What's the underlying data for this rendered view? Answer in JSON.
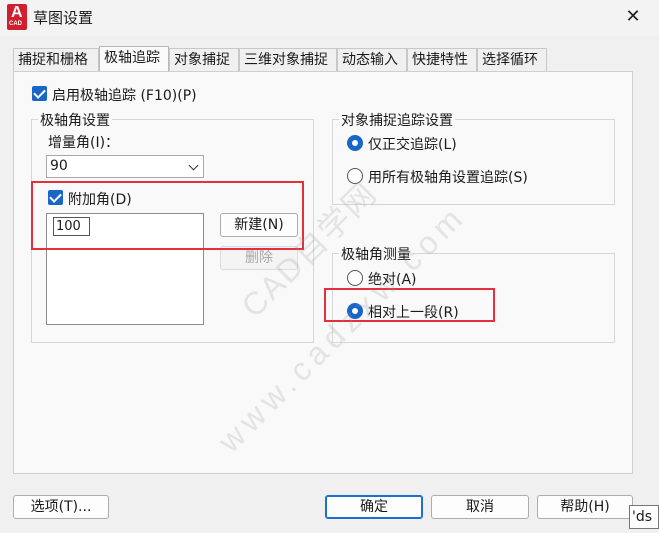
{
  "window": {
    "title": "草图设置",
    "app_icon_letter": "A",
    "app_icon_sub": "CAD",
    "close_glyph": "✕"
  },
  "tabs": [
    {
      "label": "捕捉和栅格",
      "active": false
    },
    {
      "label": "极轴追踪",
      "active": true
    },
    {
      "label": "对象捕捉",
      "active": false
    },
    {
      "label": "三维对象捕捉",
      "active": false
    },
    {
      "label": "动态输入",
      "active": false
    },
    {
      "label": "快捷特性",
      "active": false
    },
    {
      "label": "选择循环",
      "active": false
    }
  ],
  "enable_polar": {
    "label": "启用极轴追踪 (F10)(P)",
    "checked": true
  },
  "polar_angle_settings": {
    "title": "极轴角设置",
    "increment_label": "增量角(I)：",
    "increment_value": "90",
    "additional_label": "附加角(D)",
    "additional_checked": true,
    "additional_values": [
      "100"
    ],
    "new_button": "新建(N)",
    "delete_button": "删除"
  },
  "object_snap_tracking": {
    "title": "对象捕捉追踪设置",
    "options": [
      {
        "label": "仅正交追踪(L)",
        "selected": true
      },
      {
        "label": "用所有极轴角设置追踪(S)",
        "selected": false
      }
    ]
  },
  "polar_measurement": {
    "title": "极轴角测量",
    "options": [
      {
        "label": "绝对(A)",
        "selected": false
      },
      {
        "label": "相对上一段(R)",
        "selected": true
      }
    ]
  },
  "footer": {
    "options_button": "选项(T)...",
    "ok_button": "确定",
    "cancel_button": "取消",
    "help_button": "帮助(H)"
  },
  "tooltip_text": "'ds",
  "watermark": {
    "line1": "CAD自学网",
    "line2": "www.cadzxw.com"
  },
  "colors": {
    "checkbox": "#1866c8",
    "highlight_box": "#e4303c",
    "default_button_border": "#1a6fd1"
  }
}
